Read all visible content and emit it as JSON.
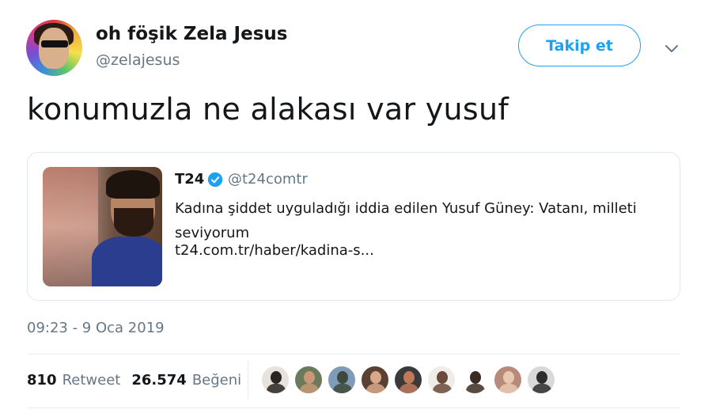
{
  "author": {
    "display_name": "oh föşik Zela Jesus",
    "handle": "@zelajesus"
  },
  "follow_button": {
    "label": "Takip et"
  },
  "tweet": {
    "text": "konumuzla ne alakası var yusuf",
    "timestamp": "09:23 - 9 Oca 2019"
  },
  "quoted_card": {
    "name": "T24",
    "handle": "@t24comtr",
    "title": "Kadına şiddet uyguladığı iddia edilen Yusuf Güney: Vatanı, milleti seviyorum",
    "link": "t24.com.tr/haber/kadina-s..."
  },
  "stats": {
    "retweets": "810",
    "retweets_label": "Retweet",
    "likes": "26.574",
    "likes_label": "Beğeni"
  },
  "liker_avatars": [
    {
      "bg": "#e8e2dc",
      "fg": "#2a2522"
    },
    {
      "bg": "#6a7a5a",
      "fg": "#c89878"
    },
    {
      "bg": "#7f9bb8",
      "fg": "#3d4a3a"
    },
    {
      "bg": "#5b4034",
      "fg": "#d9a88a"
    },
    {
      "bg": "#3a3a3a",
      "fg": "#c07a5a"
    },
    {
      "bg": "#f0ede8",
      "fg": "#6a4a3a"
    },
    {
      "bg": "#ffffff",
      "fg": "#3b2b22"
    },
    {
      "bg": "#b88a7a",
      "fg": "#e8c8b0"
    },
    {
      "bg": "#d9d9d9",
      "fg": "#2c2c2c"
    }
  ],
  "colors": {
    "accent": "#1da1f2",
    "secondary_text": "#657786",
    "primary_text": "#14171a"
  }
}
